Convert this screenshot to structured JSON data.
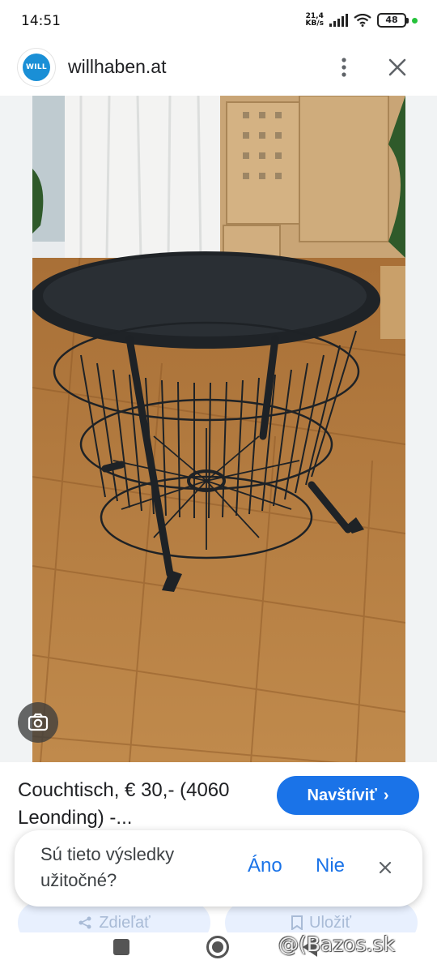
{
  "status_bar": {
    "time": "14:51",
    "net_speed_value": "21,4",
    "net_speed_unit": "KB/s",
    "battery": "48"
  },
  "header": {
    "logo_text": "WILL",
    "site": "willhaben.at"
  },
  "image": {
    "lens_icon": "google-lens-icon"
  },
  "result": {
    "title": "Couchtisch, € 30,- (4060 Leonding) -...",
    "visit_label": "Navštíviť",
    "visit_chevron": "›"
  },
  "feedback": {
    "question": "Sú tieto výsledky užitočné?",
    "yes": "Áno",
    "no": "Nie"
  },
  "actions": {
    "share_label": "Zdieľať",
    "save_label": "Uložiť"
  },
  "watermark": "@(Bazos.sk",
  "colors": {
    "accent": "#1a73e8",
    "button_ghost": "#e8f0fe",
    "wood": "#b37a3e"
  }
}
